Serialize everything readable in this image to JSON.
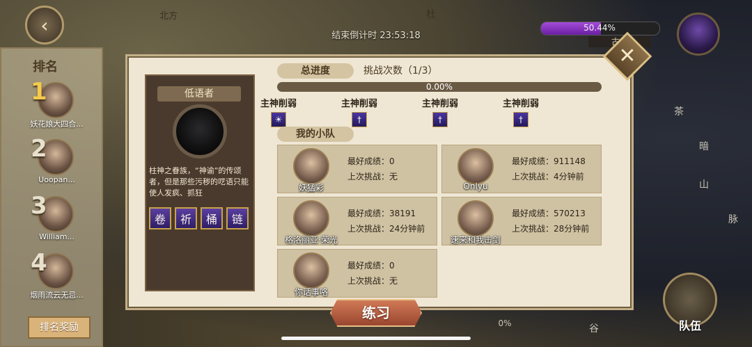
{
  "countdown": "结束倒计时 23:53:18",
  "boss_bar": {
    "percent_text": "50.44%",
    "fraction": 0.5044,
    "sub_label": "古龙"
  },
  "ranking": {
    "title": "排名",
    "reward_label": "排名奖励",
    "entries": [
      {
        "rank": "1",
        "name": "妖花娘大四合..."
      },
      {
        "rank": "2",
        "name": "Uoopan..."
      },
      {
        "rank": "3",
        "name": "William..."
      },
      {
        "rank": "4",
        "name": "烟雨流云无忌..."
      }
    ]
  },
  "boss": {
    "name": "低语者",
    "description": "柱神之眷族，“神谕”的传颂者，但是那些污秽的呓语只能使人发疯、抓狂",
    "skills": [
      "卷",
      "祈",
      "桶",
      "链"
    ]
  },
  "progress": {
    "label": "总进度",
    "challenge_count": "挑战次数（1/3）",
    "value_text": "0.00%",
    "fraction": 0.0
  },
  "debuffs": [
    {
      "label": "主神削弱",
      "icon": "sun-icon"
    },
    {
      "label": "主神削弱",
      "icon": "rune-icon"
    },
    {
      "label": "主神削弱",
      "icon": "rune-icon"
    },
    {
      "label": "主神削弱",
      "icon": "rune-icon"
    }
  ],
  "team": {
    "label": "我的小队",
    "best_label": "最好成绩：",
    "last_label": "上次挑战：",
    "members": [
      {
        "name": "妖猛彩",
        "best": "0",
        "last": "无"
      },
      {
        "name": "Onlyu",
        "best": "911148",
        "last": "4分钟前"
      },
      {
        "name": "格洛丽亚·荣光",
        "best": "38191",
        "last": "24分钟前"
      },
      {
        "name": "速来和我击剑",
        "best": "570213",
        "last": "28分钟前"
      },
      {
        "name": "你话事咯",
        "best": "0",
        "last": "无"
      }
    ]
  },
  "practice_label": "练习",
  "team_button_label": "队伍",
  "bottom_percent": "0%",
  "map_labels": {
    "a": "北方",
    "b": "暗",
    "c": "山",
    "d": "脉",
    "e": "茶",
    "f": "谷",
    "g": "杜"
  },
  "colors": {
    "accent_purple": "#8e3fd0",
    "parchment": "#efe7d4",
    "button_red": "#c0603f"
  }
}
